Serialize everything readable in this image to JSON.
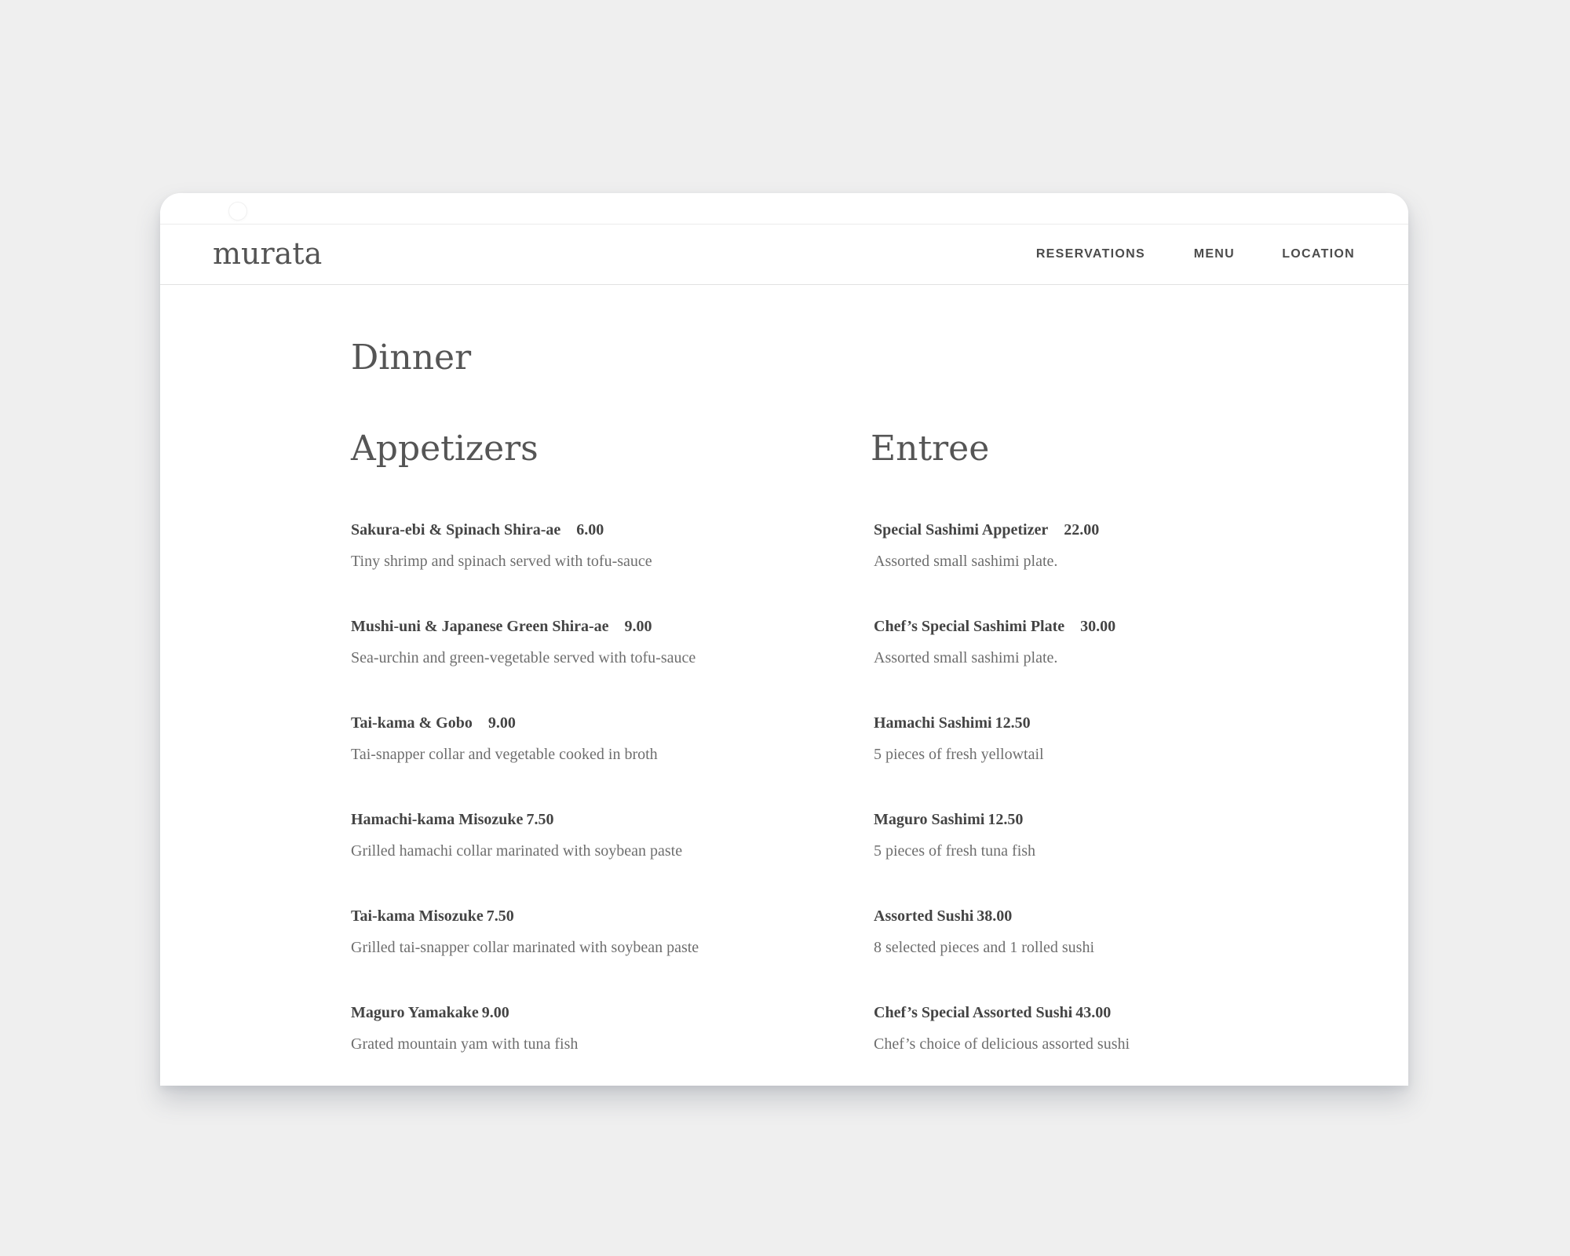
{
  "site": {
    "logo": "murata",
    "nav": [
      "RESERVATIONS",
      "MENU",
      "LOCATION"
    ]
  },
  "page": {
    "title": "Dinner"
  },
  "appetizers": {
    "title": "Appetizers",
    "items": [
      {
        "name": "Sakura-ebi & Spinach Shira-ae",
        "price": "6.00",
        "description": "Tiny shrimp and spinach served with tofu-sauce"
      },
      {
        "name": "Mushi-uni & Japanese Green Shira-ae",
        "price": "9.00",
        "description": "Sea-urchin and green-vegetable served with tofu-sauce"
      },
      {
        "name": "Tai-kama & Gobo",
        "price": "9.00",
        "description": "Tai-snapper collar and vegetable cooked in broth"
      },
      {
        "name": "Hamachi-kama Misozuke",
        "price": "7.50",
        "description": "Grilled hamachi collar marinated with soybean paste"
      },
      {
        "name": "Tai-kama Misozuke",
        "price": "7.50",
        "description": "Grilled tai-snapper collar marinated with soybean paste"
      },
      {
        "name": "Maguro Yamakake",
        "price": "9.00",
        "description": "Grated mountain yam with tuna fish"
      }
    ]
  },
  "entree": {
    "title": "Entree",
    "items": [
      {
        "name": "Special Sashimi Appetizer",
        "price": "22.00",
        "description": "Assorted small sashimi plate."
      },
      {
        "name": "Chef’s Special Sashimi Plate",
        "price": "30.00",
        "description": "Assorted small sashimi plate."
      },
      {
        "name": "Hamachi Sashimi",
        "price": "12.50",
        "description": "5 pieces of fresh yellowtail"
      },
      {
        "name": "Maguro Sashimi",
        "price": "12.50",
        "description": "5 pieces of fresh tuna fish"
      },
      {
        "name": "Assorted Sushi",
        "price": "38.00",
        "description": "8 selected pieces and 1 rolled sushi"
      },
      {
        "name": "Chef’s Special Assorted Sushi",
        "price": "43.00",
        "description": "Chef’s choice of delicious assorted sushi"
      }
    ]
  }
}
